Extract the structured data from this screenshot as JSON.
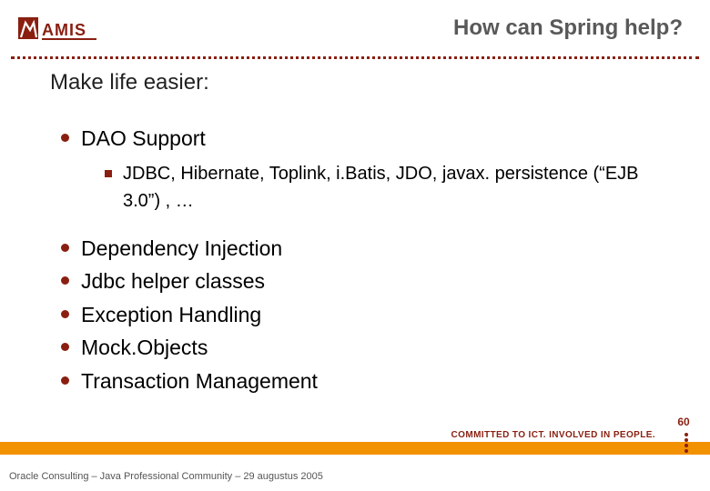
{
  "brand": {
    "logo_text": "AMIS",
    "logo_color": "#8a1f11",
    "accent_color": "#f39200"
  },
  "title": "How can Spring help?",
  "subtitle": "Make life easier:",
  "bullets": {
    "b0": "DAO Support",
    "b0_sub0": "JDBC, Hibernate, Toplink, i.Batis, JDO, javax. persistence (“EJB 3.0”) , …",
    "b1": "Dependency Injection",
    "b2": "Jdbc helper classes",
    "b3": "Exception Handling",
    "b4": "Mock.Objects",
    "b5": "Transaction Management"
  },
  "tagline": "COMMITTED TO ICT. INVOLVED IN PEOPLE.",
  "footer": "Oracle Consulting – Java Professional Community – 29 augustus 2005",
  "page_number": "60"
}
